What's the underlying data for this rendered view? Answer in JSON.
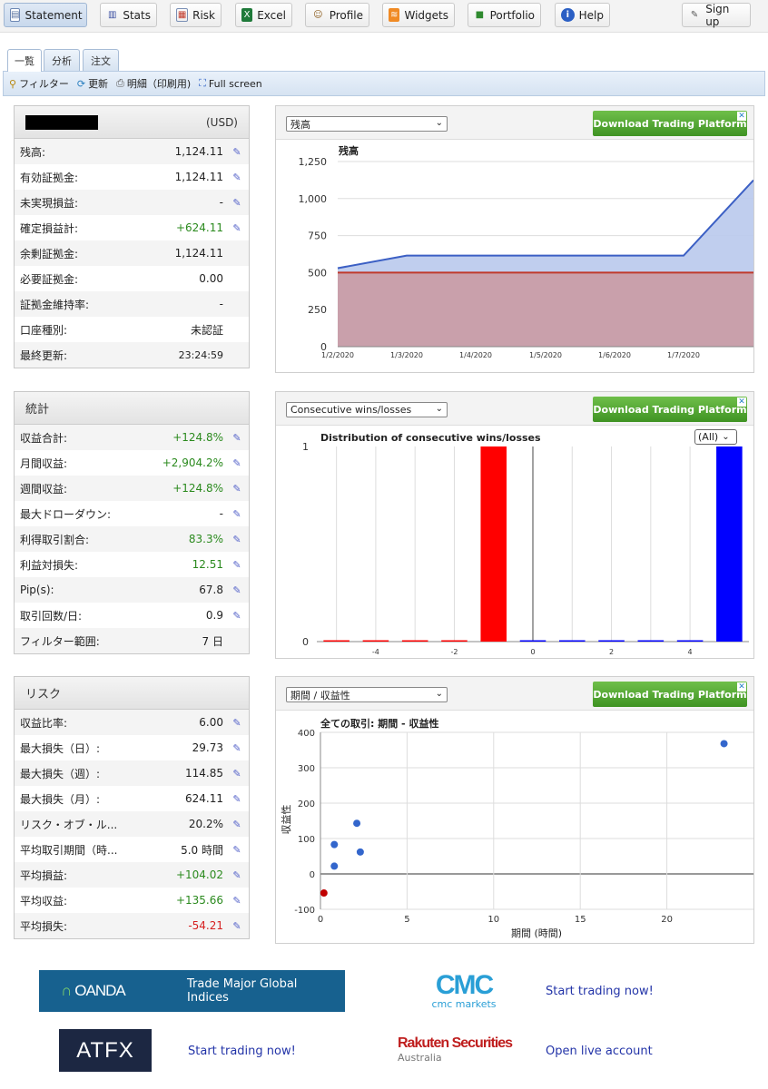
{
  "nav": {
    "buttons": [
      {
        "label": "Statement",
        "icon": "statement-icon",
        "active": true
      },
      {
        "label": "Stats",
        "icon": "stats-icon"
      },
      {
        "label": "Risk",
        "icon": "risk-icon"
      },
      {
        "label": "Excel",
        "icon": "excel-icon"
      },
      {
        "label": "Profile",
        "icon": "profile-icon"
      },
      {
        "label": "Widgets",
        "icon": "widgets-icon"
      },
      {
        "label": "Portfolio",
        "icon": "portfolio-icon"
      },
      {
        "label": "Help",
        "icon": "help-icon"
      },
      {
        "label": "Sign up",
        "icon": "signup-icon"
      }
    ]
  },
  "tabs": [
    {
      "label": "一覧",
      "active": true
    },
    {
      "label": "分析"
    },
    {
      "label": "注文"
    }
  ],
  "toolbar": {
    "filter": "フィルター",
    "refresh": "更新",
    "print": "明細（印刷用)",
    "fullscreen": "Full screen"
  },
  "account": {
    "name_redacted": true,
    "currency": "(USD)",
    "rows": [
      {
        "label": "残高:",
        "value": "1,124.11",
        "edit": true
      },
      {
        "label": "有効証拠金:",
        "value": "1,124.11",
        "edit": true
      },
      {
        "label": "未実現損益:",
        "value": "-",
        "edit": true
      },
      {
        "label": "確定損益計:",
        "value": "+624.11",
        "color": "green",
        "edit": true
      },
      {
        "label": "余剰証拠金:",
        "value": "1,124.11"
      },
      {
        "label": "必要証拠金:",
        "value": "0.00"
      },
      {
        "label": "証拠金維持率:",
        "value": "-"
      },
      {
        "label": "口座種別:",
        "value": "未認証"
      },
      {
        "label": "最終更新:",
        "value": "23:24:59",
        "small": true
      }
    ]
  },
  "stats": {
    "title": "統計",
    "rows": [
      {
        "label": "収益合計:",
        "value": "+124.8%",
        "color": "green",
        "edit": true
      },
      {
        "label": "月間収益:",
        "value": "+2,904.2%",
        "color": "green",
        "edit": true
      },
      {
        "label": "週間収益:",
        "value": "+124.8%",
        "color": "green",
        "edit": true
      },
      {
        "label": "最大ドローダウン:",
        "value": "-",
        "edit": true
      },
      {
        "label": "利得取引割合:",
        "value": "83.3%",
        "color": "green",
        "edit": true
      },
      {
        "label": "利益対損失:",
        "value": "12.51",
        "color": "green",
        "edit": true
      },
      {
        "label": "Pip(s):",
        "value": "67.8",
        "edit": true
      },
      {
        "label": "取引回数/日:",
        "value": "0.9",
        "edit": true
      },
      {
        "label": "フィルター範囲:",
        "value": "7 日"
      }
    ]
  },
  "risk": {
    "title": "リスク",
    "rows": [
      {
        "label": "収益比率:",
        "value": "6.00",
        "edit": true
      },
      {
        "label": "最大損失（日）:",
        "value": "29.73",
        "edit": true
      },
      {
        "label": "最大損失（週）:",
        "value": "114.85",
        "edit": true
      },
      {
        "label": "最大損失（月）:",
        "value": "624.11",
        "edit": true
      },
      {
        "label": "リスク・オブ・ル...",
        "value": "20.2%",
        "edit": true
      },
      {
        "label": "平均取引期間（時...",
        "value": "5.0 時間",
        "edit": true
      },
      {
        "label": "平均損益:",
        "value": "+104.02",
        "color": "green",
        "edit": true
      },
      {
        "label": "平均収益:",
        "value": "+135.66",
        "color": "green",
        "edit": true
      },
      {
        "label": "平均損失:",
        "value": "-54.21",
        "color": "red",
        "edit": true
      }
    ]
  },
  "ad_label": "Download Trading Platform",
  "charts": {
    "balance": {
      "select": "残高"
    },
    "consecutive": {
      "select": "Consecutive wins/losses",
      "filter": "(All)"
    },
    "scatter": {
      "select": "期間 / 収益性"
    }
  },
  "chart_data": [
    {
      "type": "area",
      "title": "残高",
      "x": [
        "1/2/2020",
        "1/3/2020",
        "1/4/2020",
        "1/5/2020",
        "1/6/2020",
        "1/7/2020",
        "1/7/2020"
      ],
      "x_ticks": [
        "1/2/2020",
        "1/3/2020",
        "1/4/2020",
        "1/5/2020",
        "1/6/2020",
        "1/7/2020"
      ],
      "series": [
        {
          "values": [
            530,
            615,
            615,
            615,
            615,
            615,
            1124.11
          ],
          "color": "#3b5fc4"
        },
        {
          "values": [
            500,
            500,
            500,
            500,
            500,
            500,
            500
          ],
          "color": "#c0392b"
        }
      ],
      "ylim": [
        0,
        1250
      ],
      "yticks": [
        0,
        250,
        500,
        750,
        1000,
        1250
      ],
      "grid": "horizontal"
    },
    {
      "type": "bar",
      "title": "Distribution of consecutive wins/losses",
      "x": [
        -5,
        -4,
        -3,
        -2,
        -1,
        0,
        1,
        2,
        3,
        4,
        5
      ],
      "x_ticks": [
        -4,
        -2,
        0,
        2,
        4
      ],
      "values": [
        0,
        0,
        0,
        0,
        1,
        0,
        0,
        0,
        0,
        0,
        1
      ],
      "colors_negative": "#ff0000",
      "colors_positive": "#0000ff",
      "ylim": [
        0,
        1
      ],
      "yticks": [
        0,
        1
      ]
    },
    {
      "type": "scatter",
      "title": "全ての取引: 期間 - 収益性",
      "xlabel": "期間 (時間)",
      "ylabel": "収益性",
      "xlim": [
        0,
        25
      ],
      "ylim": [
        -100,
        400
      ],
      "xticks": [
        0,
        5,
        10,
        15,
        20
      ],
      "yticks": [
        -100,
        0,
        100,
        200,
        300,
        400
      ],
      "points": [
        {
          "x": 0.2,
          "y": -54,
          "color": "#c00000"
        },
        {
          "x": 0.8,
          "y": 22,
          "color": "#3366cc"
        },
        {
          "x": 0.8,
          "y": 83,
          "color": "#3366cc"
        },
        {
          "x": 2.1,
          "y": 143,
          "color": "#3366cc"
        },
        {
          "x": 2.3,
          "y": 62,
          "color": "#3366cc"
        },
        {
          "x": 23.3,
          "y": 368,
          "color": "#3366cc"
        }
      ]
    }
  ],
  "ads": {
    "oanda_logo": "OANDA",
    "oanda_text": "Trade Major Global Indices",
    "cmc_logo": "CMC",
    "cmc_sub": "cmc markets",
    "cmc_link": "Start trading now!",
    "atfx_logo": "ATFX",
    "atfx_link": "Start trading now!",
    "rakuten_logo": "Rakuten Securities",
    "rakuten_sub": "Australia",
    "rakuten_link": "Open live account"
  }
}
